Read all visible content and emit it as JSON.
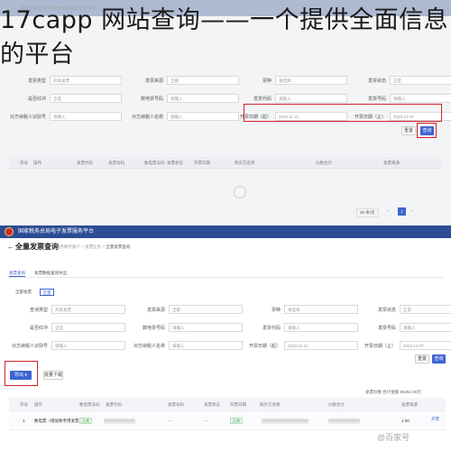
{
  "overlay": {
    "title": "17capp 网站查询——一个提供全面信息的平台"
  },
  "top": {
    "header_title": "国家税务总局全国增值税发票查验平台",
    "form_rows": [
      [
        {
          "label": "发票类型",
          "value": "开具发票"
        },
        {
          "label": "发票来源",
          "value": "全部"
        },
        {
          "label": "票种",
          "value": "请选择"
        },
        {
          "label": "发票状态",
          "value": "正常"
        }
      ],
      [
        {
          "label": "是否红冲",
          "value": "全选"
        },
        {
          "label": "数电票号码",
          "value": "请输入"
        },
        {
          "label": "发票代码",
          "value": "请输入"
        },
        {
          "label": "发票号码",
          "value": "请输入"
        }
      ],
      [
        {
          "label": "对方纳税人识别号",
          "value": "请输入"
        },
        {
          "label": "对方纳税人名称",
          "value": "请输入"
        },
        {
          "label": "开票日期（起）",
          "value": "2023-11-21"
        },
        {
          "label": "开票日期（止）",
          "value": "2023-12-07"
        }
      ]
    ],
    "reset_label": "重置",
    "query_label": "查询",
    "table_headers": [
      "序号",
      "操作",
      "发票代码",
      "发票号码",
      "数电票号码",
      "发票状态",
      "开票日期",
      "购买方名称",
      "价税合计",
      "发票来源"
    ],
    "page_size": "20 条/页",
    "current_page": "1"
  },
  "bottom": {
    "header_title": "国家税务总局电子发票服务平台",
    "page_title": "全量发票查询",
    "breadcrumb": [
      "税务数字账户",
      "发票业务",
      "全量发票查询"
    ],
    "tabs": [
      "发票查询",
      "发票数据查询导出"
    ],
    "sub_tabs": [
      "全部发票",
      "全量"
    ],
    "form_rows": [
      [
        {
          "label": "查询类型",
          "value": "开具发票"
        },
        {
          "label": "发票来源",
          "value": "全部"
        },
        {
          "label": "票种",
          "value": "请选择"
        },
        {
          "label": "发票状态",
          "value": "正常"
        }
      ],
      [
        {
          "label": "是否红冲",
          "value": "全选"
        },
        {
          "label": "数电票号码",
          "value": "请输入"
        },
        {
          "label": "发票代码",
          "value": "请输入"
        },
        {
          "label": "发票号码",
          "value": "请输入"
        }
      ],
      [
        {
          "label": "对方纳税人识别号",
          "value": "请输入"
        },
        {
          "label": "对方纳税人名称",
          "value": "请输入"
        },
        {
          "label": "开票日期（起）",
          "value": "2023-11-21"
        },
        {
          "label": "开票日期（止）",
          "value": "2023-12-07"
        }
      ]
    ],
    "reset_label": "重置",
    "query_label": "查询",
    "export_label": "导出",
    "batch_download_label": "批量下载",
    "summary": "发票份数 合计金额 ¥5351.96元",
    "table_headers": [
      "序号",
      "操作",
      "数电票号码",
      "发票代码",
      "发票号码",
      "发票状态",
      "开票日期",
      "购买方名称",
      "价税合计",
      "发票来源"
    ],
    "row": {
      "index": "1",
      "action": "查看详情",
      "type": "数电票（增值税专用发票）",
      "status": "正常",
      "amount": "1.00",
      "source": "开票"
    },
    "watermark": "@百家号"
  },
  "colors": {
    "header_blue": "#2c4c94",
    "accent_blue": "#3c64d2",
    "highlight_red": "#d2222a"
  }
}
